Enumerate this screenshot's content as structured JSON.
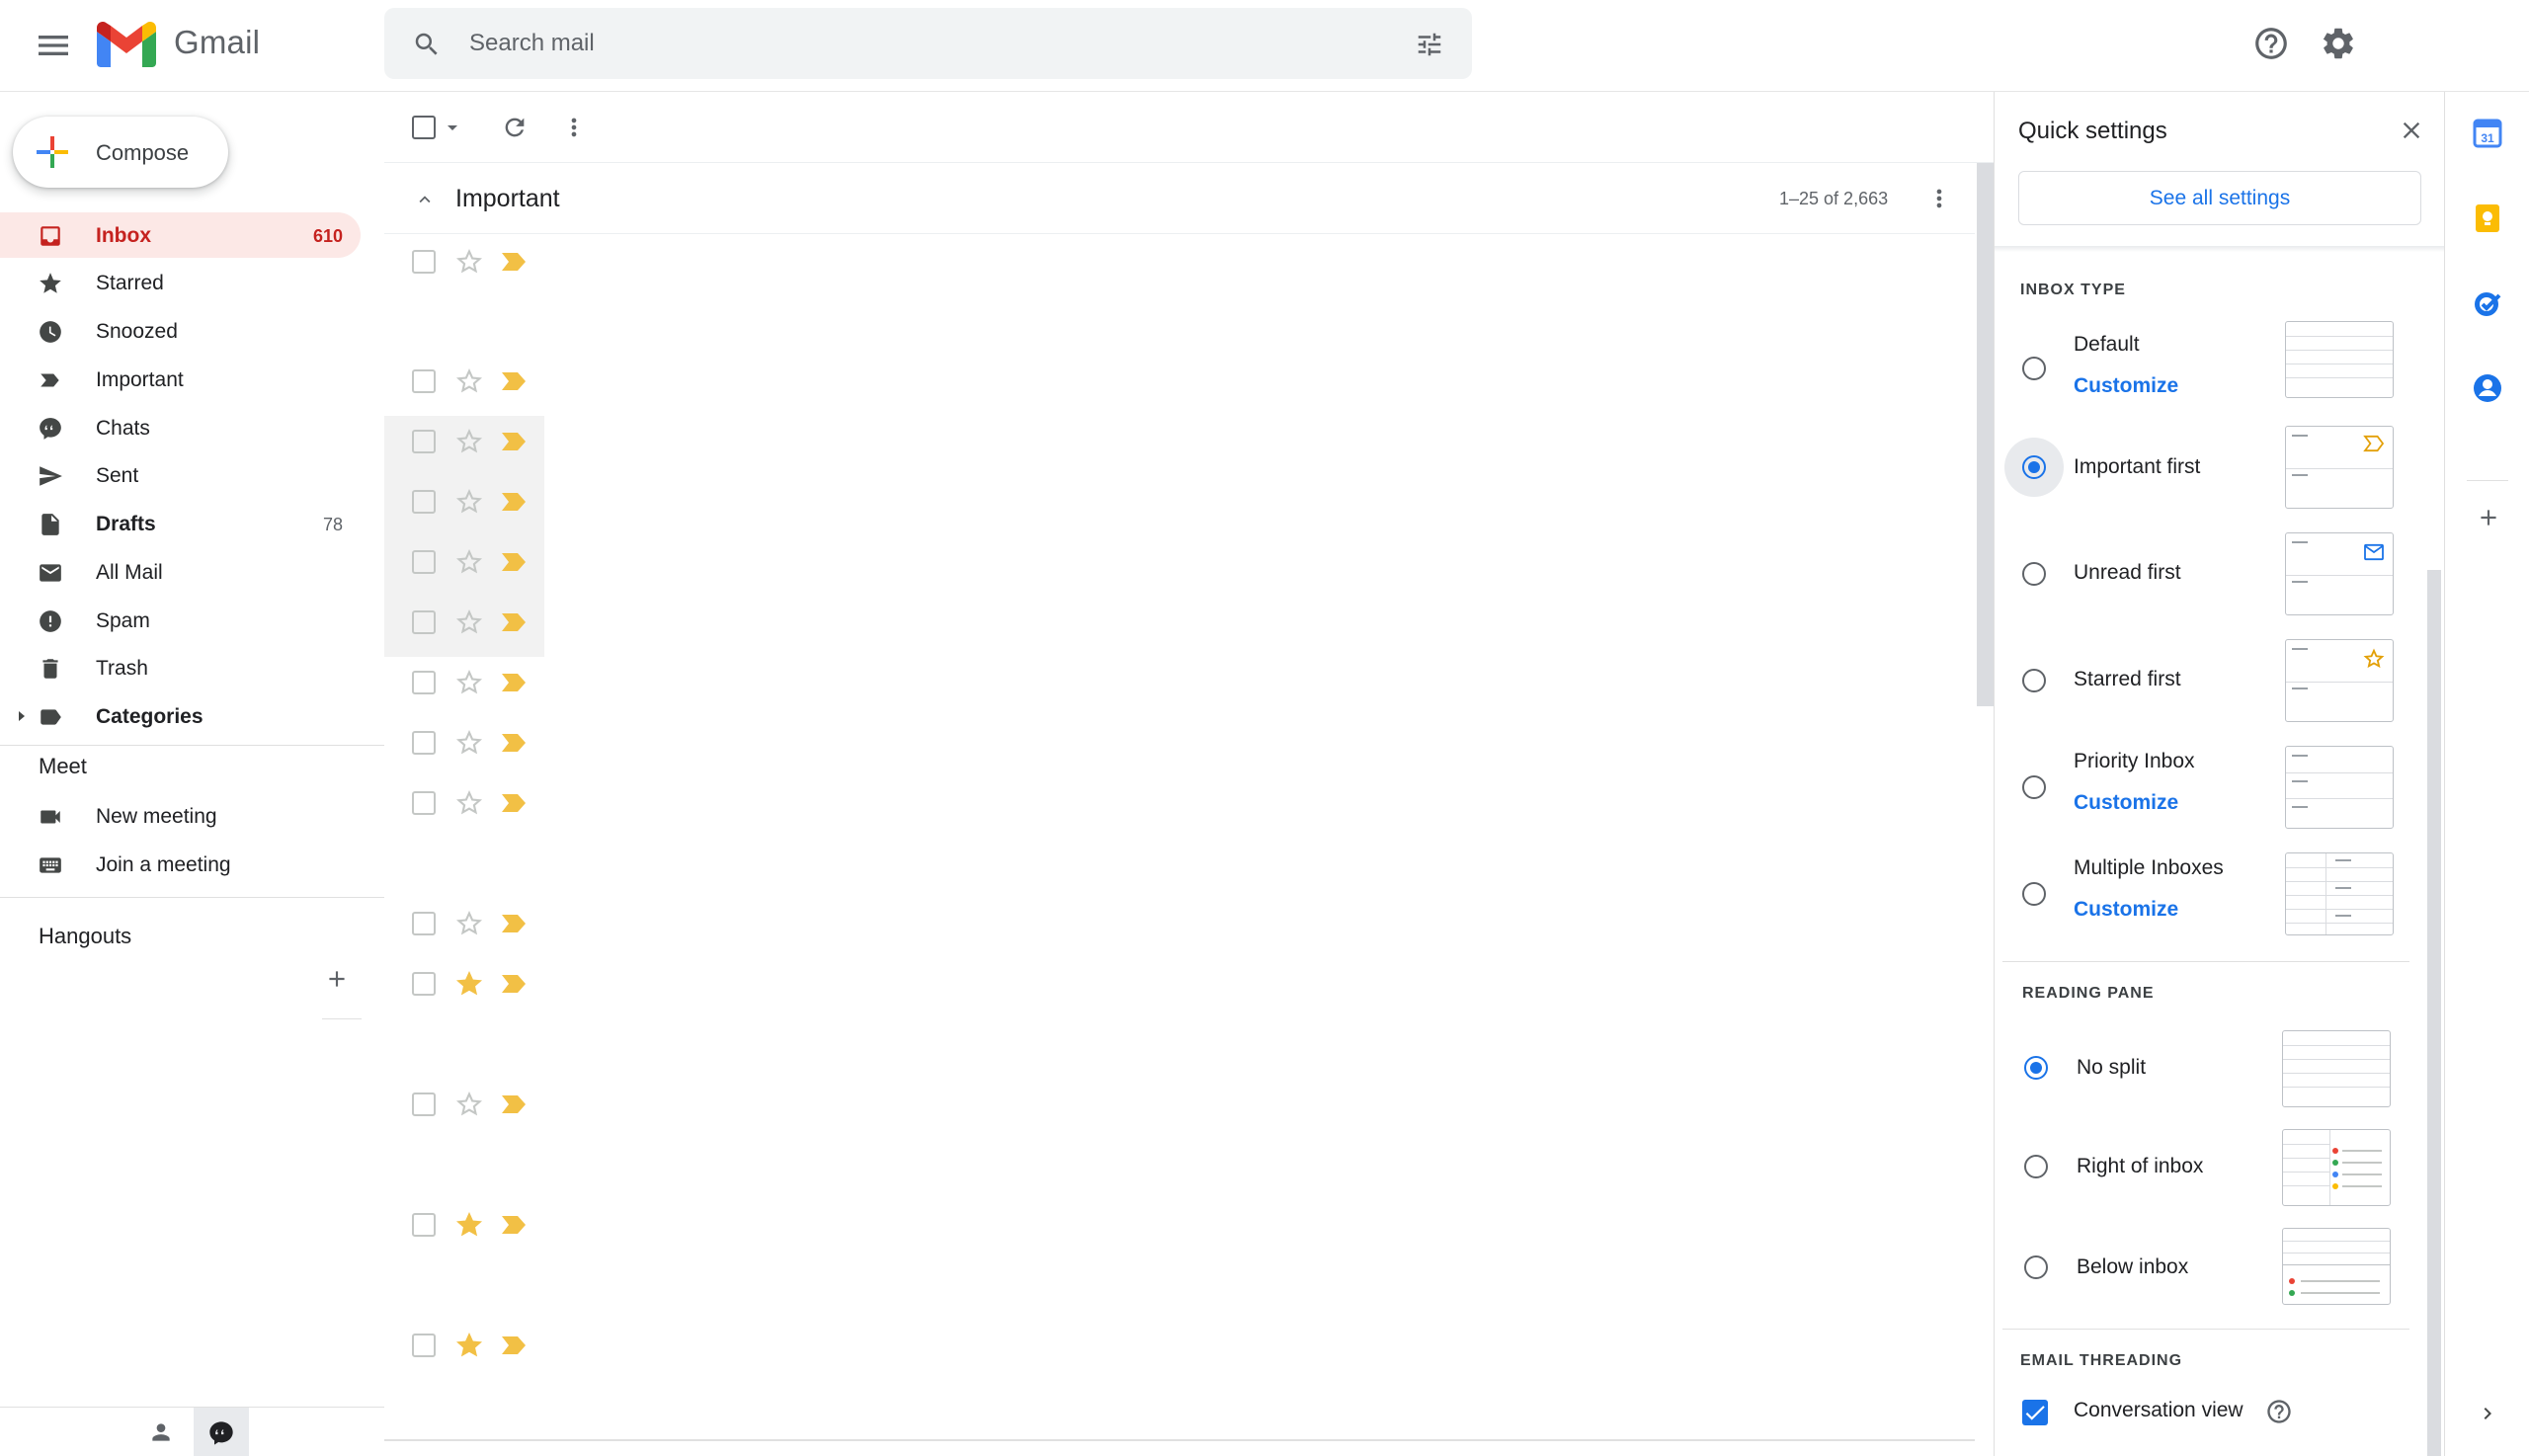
{
  "header": {
    "app_name": "Gmail",
    "search_placeholder": "Search mail"
  },
  "sidebar": {
    "compose_label": "Compose",
    "items": [
      {
        "label": "Inbox",
        "count": "610"
      },
      {
        "label": "Starred",
        "count": ""
      },
      {
        "label": "Snoozed",
        "count": ""
      },
      {
        "label": "Important",
        "count": ""
      },
      {
        "label": "Chats",
        "count": ""
      },
      {
        "label": "Sent",
        "count": ""
      },
      {
        "label": "Drafts",
        "count": "78"
      },
      {
        "label": "All Mail",
        "count": ""
      },
      {
        "label": "Spam",
        "count": ""
      },
      {
        "label": "Trash",
        "count": ""
      },
      {
        "label": "Categories",
        "count": ""
      }
    ],
    "meet": {
      "title": "Meet",
      "new_meeting": "New meeting",
      "join_meeting": "Join a meeting"
    },
    "hangouts_title": "Hangouts"
  },
  "main": {
    "section_title": "Important",
    "range": "1–25 of 2,663"
  },
  "quick_settings": {
    "title": "Quick settings",
    "see_all": "See all settings",
    "inbox_type_title": "INBOX TYPE",
    "inbox_types": [
      {
        "label": "Default",
        "link": "Customize"
      },
      {
        "label": "Important first",
        "link": ""
      },
      {
        "label": "Unread first",
        "link": ""
      },
      {
        "label": "Starred first",
        "link": ""
      },
      {
        "label": "Priority Inbox",
        "link": "Customize"
      },
      {
        "label": "Multiple Inboxes",
        "link": "Customize"
      }
    ],
    "selected_inbox_type": "Important first",
    "reading_pane_title": "READING PANE",
    "reading_pane": [
      {
        "label": "No split"
      },
      {
        "label": "Right of inbox"
      },
      {
        "label": "Below inbox"
      }
    ],
    "selected_reading_pane": "No split",
    "threading_title": "EMAIL THREADING",
    "conversation_view": "Conversation view",
    "conversation_view_checked": true
  },
  "colors": {
    "accent": "#1a73e8",
    "inbox_active": "#c5221f",
    "important_marker": "#f2c045",
    "star": "#f2c045"
  }
}
